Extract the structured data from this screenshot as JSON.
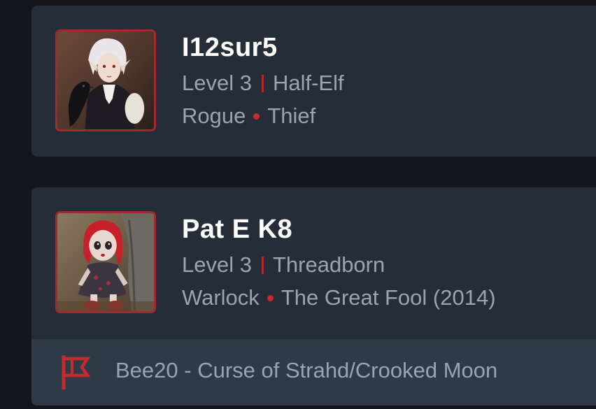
{
  "characters": [
    {
      "name": "I12sur5",
      "level": "Level 3",
      "race": "Half-Elf",
      "class": "Rogue",
      "subclass": "Thief",
      "avatar_icon": "elf-portrait"
    },
    {
      "name": "Pat E K8",
      "level": "Level 3",
      "race": "Threadborn",
      "class": "Warlock",
      "subclass": "The Great Fool (2014)",
      "avatar_icon": "doll-portrait",
      "campaign": {
        "icon": "flag-icon",
        "label": "Bee20 - Curse of Strahd/Crooked Moon"
      }
    }
  ],
  "colors": {
    "background": "#13161c",
    "card": "#252d38",
    "campaign_bar": "#2f3a47",
    "accent_red": "#c62a2f",
    "name_text": "#ffffff",
    "secondary_text": "#9aa3ae"
  }
}
